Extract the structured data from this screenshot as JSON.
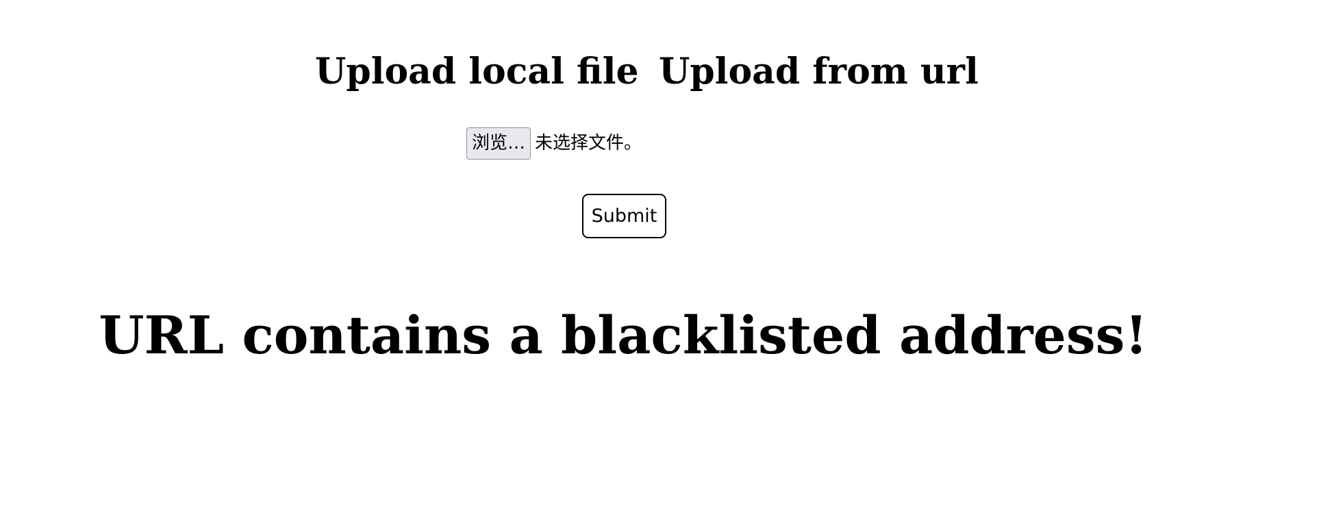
{
  "tabs": {
    "local_label": "Upload local file",
    "url_label": "Upload from url"
  },
  "file_input": {
    "browse_label": "浏览…",
    "status_text": "未选择文件。"
  },
  "form": {
    "submit_label": "Submit"
  },
  "message": {
    "text": "URL contains a blacklisted address!"
  }
}
